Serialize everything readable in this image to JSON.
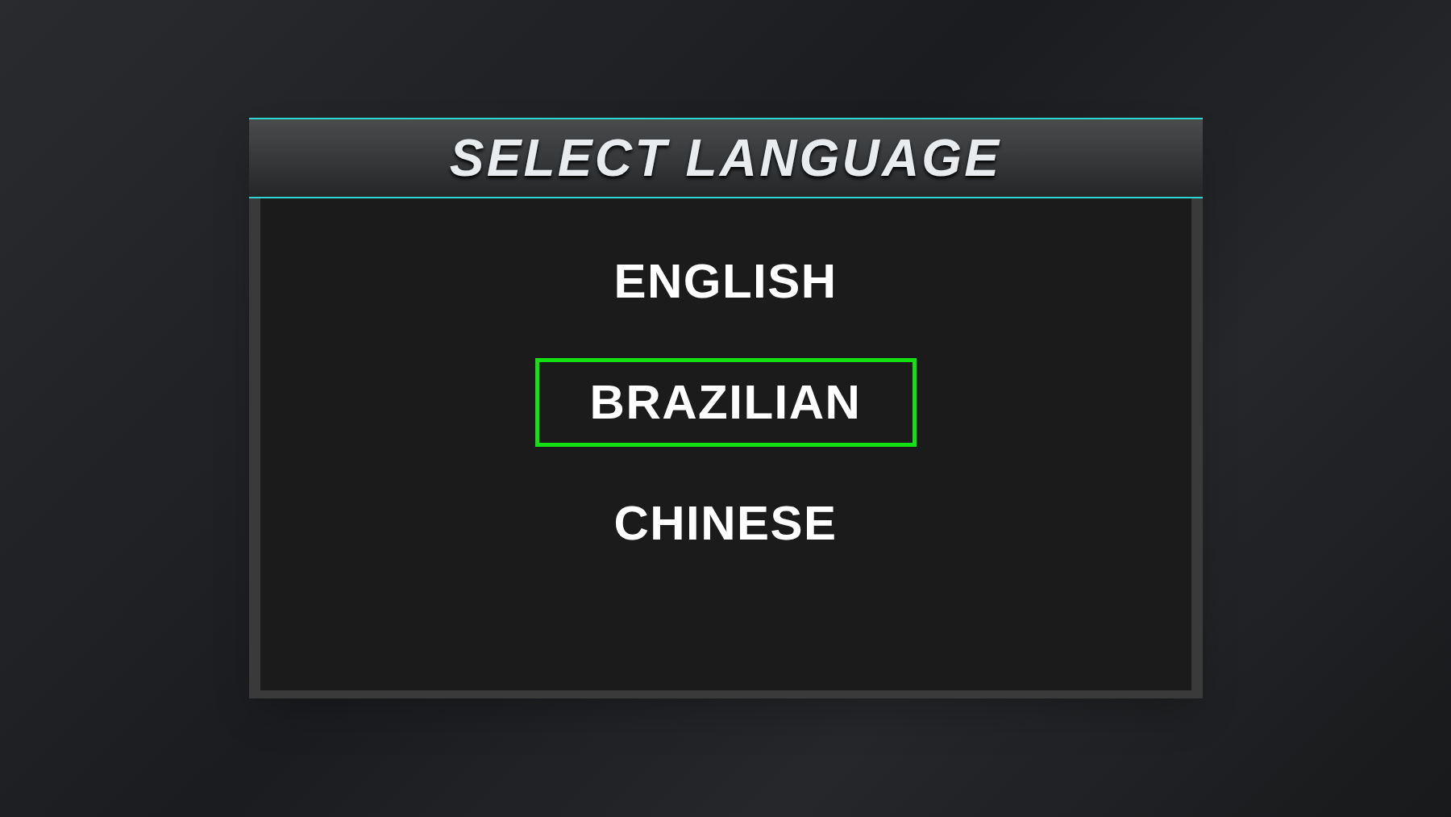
{
  "title": "SELECT LANGUAGE",
  "languages": [
    {
      "label": "ENGLISH",
      "selected": false
    },
    {
      "label": "BRAZILIAN",
      "selected": true
    },
    {
      "label": "CHINESE",
      "selected": false
    }
  ]
}
